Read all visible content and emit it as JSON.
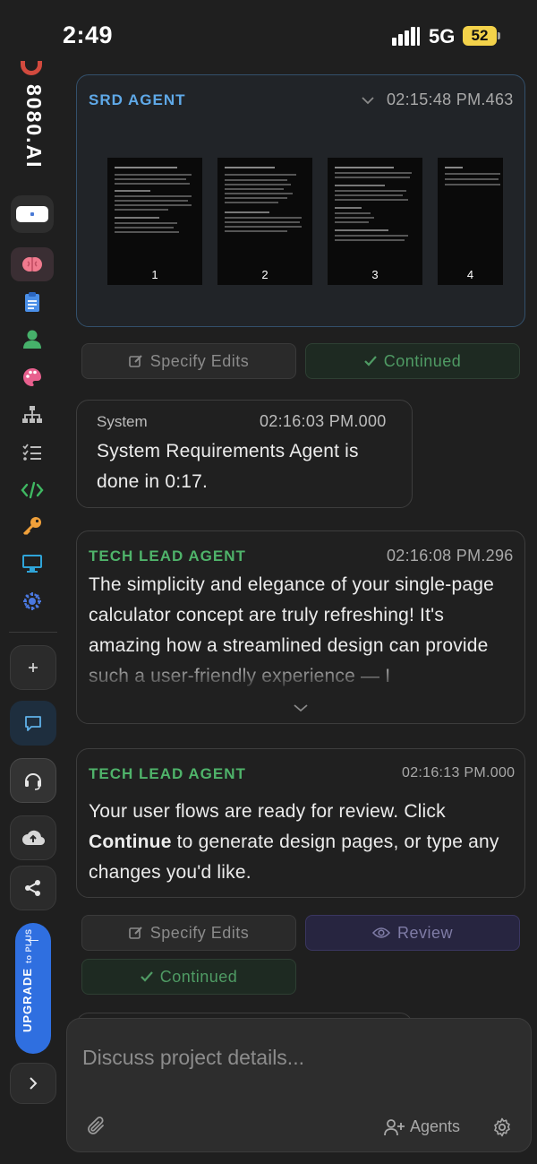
{
  "status_bar": {
    "time": "2:49",
    "network": "5G",
    "battery": "52"
  },
  "sidebar": {
    "brand": "8080.AI",
    "nav_icons": [
      "brain-icon",
      "clipboard-icon",
      "user-icon",
      "palette-icon",
      "sitemap-icon",
      "checklist-icon",
      "code-icon",
      "key-icon",
      "monitor-icon",
      "gear-network-icon"
    ],
    "upgrade": {
      "label": "UPGRADE",
      "sub": "to PLUS"
    }
  },
  "feed": {
    "srd_card": {
      "agent": "SRD AGENT",
      "timestamp": "02:15:48 PM.463",
      "pages": [
        "1",
        "2",
        "3",
        "4"
      ]
    },
    "srd_actions": {
      "edit_label": "Specify Edits",
      "continued_label": "Continued"
    },
    "system_card": {
      "agent": "System",
      "timestamp": "02:16:03 PM.000",
      "message": "System Requirements Agent is done in 0:17."
    },
    "tech_lead_card_1": {
      "agent": "TECH LEAD AGENT",
      "timestamp": "02:16:08 PM.296",
      "message": "The simplicity and elegance of your single-page calculator concept are truly refreshing! It's amazing how a streamlined design can provide such a user-friendly experience — I"
    },
    "tech_lead_card_2": {
      "agent": "TECH LEAD AGENT",
      "timestamp": "02:16:13 PM.000",
      "message_pre": "Your user flows are ready for review. Click ",
      "message_bold": "Continue",
      "message_post": " to generate design pages, or type any changes you'd like."
    },
    "flow_actions": {
      "edit_label": "Specify Edits",
      "review_label": "Review",
      "continued_label": "Continued"
    }
  },
  "composer": {
    "placeholder": "Discuss project details...",
    "agents_label": "Agents"
  },
  "colors": {
    "srd_label": "#5fa9e8",
    "tech_lead_label": "#4fb36a",
    "upgrade": "#2f6fe0",
    "battery": "#f3d24a"
  }
}
